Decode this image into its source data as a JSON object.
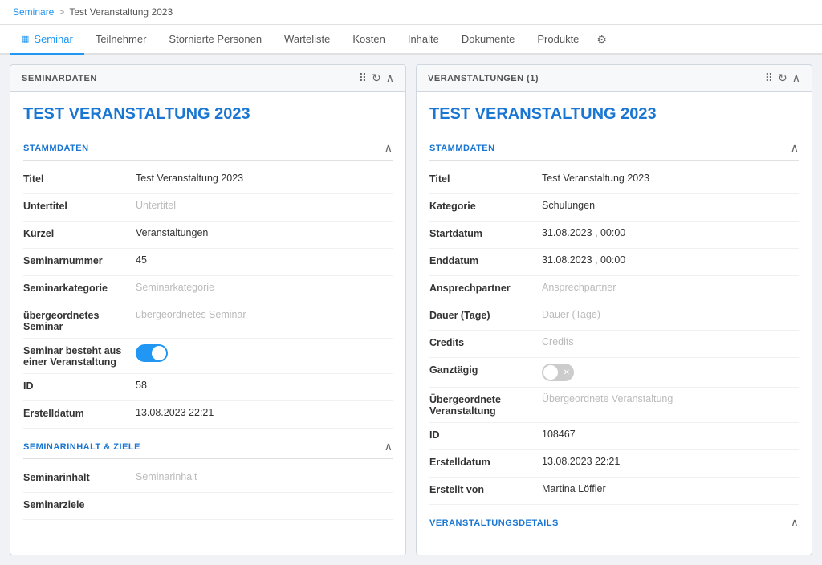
{
  "breadcrumb": {
    "link": "Seminare",
    "separator": ">",
    "current": "Test Veranstaltung 2023"
  },
  "tabs": [
    {
      "id": "seminar",
      "label": "Seminar",
      "icon": "▦",
      "active": true
    },
    {
      "id": "teilnehmer",
      "label": "Teilnehmer",
      "active": false
    },
    {
      "id": "stornierte",
      "label": "Stornierte Personen",
      "active": false
    },
    {
      "id": "warteliste",
      "label": "Warteliste",
      "active": false
    },
    {
      "id": "kosten",
      "label": "Kosten",
      "active": false
    },
    {
      "id": "inhalte",
      "label": "Inhalte",
      "active": false
    },
    {
      "id": "dokumente",
      "label": "Dokumente",
      "active": false
    },
    {
      "id": "produkte",
      "label": "Produkte",
      "active": false
    }
  ],
  "left_panel": {
    "header": "SEMINARDATEN",
    "main_title": "TEST VERANSTALTUNG 2023",
    "stammdaten": {
      "label": "STAMMDATEN",
      "fields": [
        {
          "label": "Titel",
          "value": "Test Veranstaltung 2023",
          "placeholder": false
        },
        {
          "label": "Untertitel",
          "value": "Untertitel",
          "placeholder": true
        },
        {
          "label": "Kürzel",
          "value": "Veranstaltungen",
          "placeholder": false
        },
        {
          "label": "Seminarnummer",
          "value": "45",
          "placeholder": false
        },
        {
          "label": "Seminarkategorie",
          "value": "Seminarkategorie",
          "placeholder": true
        },
        {
          "label": "übergeordnetes Seminar",
          "value": "übergeordnetes Seminar",
          "placeholder": true
        }
      ],
      "toggle_field": {
        "label": "Seminar besteht aus einer Veranstaltung",
        "value": true
      },
      "bottom_fields": [
        {
          "label": "ID",
          "value": "58",
          "placeholder": false
        },
        {
          "label": "Erstelldatum",
          "value": "13.08.2023 22:21",
          "placeholder": false
        }
      ]
    },
    "seminarinhalt": {
      "label": "SEMINARINHALT & ZIELE",
      "fields": [
        {
          "label": "Seminarinhalt",
          "value": "Seminarinhalt",
          "placeholder": true
        },
        {
          "label": "Seminarziele",
          "value": "",
          "placeholder": false
        }
      ]
    }
  },
  "right_panel": {
    "header": "VERANSTALTUNGEN (1)",
    "main_title": "TEST VERANSTALTUNG 2023",
    "stammdaten": {
      "label": "STAMMDATEN",
      "fields": [
        {
          "label": "Titel",
          "value": "Test Veranstaltung 2023",
          "placeholder": false
        },
        {
          "label": "Kategorie",
          "value": "Schulungen",
          "placeholder": false
        },
        {
          "label": "Startdatum",
          "value": "31.08.2023 ,  00:00",
          "placeholder": false
        },
        {
          "label": "Enddatum",
          "value": "31.08.2023 ,  00:00",
          "placeholder": false
        },
        {
          "label": "Ansprechpartner",
          "value": "Ansprechpartner",
          "placeholder": true
        },
        {
          "label": "Dauer (Tage)",
          "value": "Dauer (Tage)",
          "placeholder": true
        },
        {
          "label": "Credits",
          "value": "Credits",
          "placeholder": true
        }
      ],
      "toggle_field": {
        "label": "Ganztägig",
        "value": false
      },
      "bottom_fields": [
        {
          "label": "Übergeordnete Veranstaltung",
          "value": "Übergeordnete Veranstaltung",
          "placeholder": true
        },
        {
          "label": "ID",
          "value": "108467",
          "placeholder": false
        },
        {
          "label": "Erstelldatum",
          "value": "13.08.2023 22:21",
          "placeholder": false
        },
        {
          "label": "Erstellt von",
          "value": "Martina Löffler",
          "placeholder": false
        }
      ]
    },
    "veranstaltungsdetails": {
      "label": "VERANSTALTUNGSDETAILS"
    }
  }
}
